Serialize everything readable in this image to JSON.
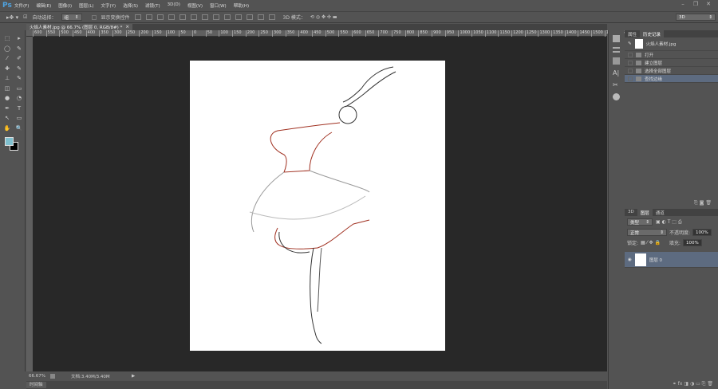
{
  "app": {
    "logo": "Ps"
  },
  "menu": [
    "文件(F)",
    "编辑(E)",
    "图像(I)",
    "图层(L)",
    "文字(Y)",
    "选择(S)",
    "滤镜(T)",
    "3D(D)",
    "视图(V)",
    "窗口(W)",
    "帮助(H)"
  ],
  "window_controls": [
    "–",
    "❐",
    "✕"
  ],
  "options": {
    "auto_select_label": "自动选择：",
    "auto_select_value": "组",
    "show_transform": "显示变换控件",
    "mode_3d": "3D 模式：",
    "workspace": "3D"
  },
  "document": {
    "tab_title": "火焰人素材.jpg @ 66.7% (图层 0, RGB/8#) *",
    "close": "×"
  },
  "ruler_labels": [
    "600",
    "550",
    "500",
    "450",
    "400",
    "350",
    "300",
    "250",
    "200",
    "150",
    "100",
    "50",
    "0",
    "50",
    "100",
    "150",
    "200",
    "250",
    "300",
    "350",
    "400",
    "450",
    "500",
    "550",
    "600",
    "650",
    "700",
    "750",
    "800",
    "850",
    "900",
    "950",
    "1000",
    "1050",
    "1100",
    "1150",
    "1200",
    "1250",
    "1300",
    "1350",
    "1400",
    "1450",
    "1500",
    "1550",
    "1600"
  ],
  "status": {
    "zoom": "66.67%",
    "doc": "文档:3.40M/3.40M",
    "arrow": "▶"
  },
  "timeline": {
    "label": "时间轴"
  },
  "history": {
    "tabs": [
      "属性",
      "历史记录"
    ],
    "active": 1,
    "snapshot": "火焰人素材.jpg",
    "items": [
      "打开",
      "建立图层",
      "选择全部图层",
      "查找边缘"
    ],
    "selected": 3
  },
  "layers": {
    "tabs": [
      "3D",
      "图层",
      "通道"
    ],
    "active": 1,
    "filter": "类型",
    "blend": "正常",
    "opacity_label": "不透明度:",
    "opacity": "100%",
    "lock_label": "锁定:",
    "fill_label": "填充:",
    "fill": "100%",
    "items": [
      {
        "name": "图层 0"
      }
    ]
  },
  "colors": {
    "foreground": "#7fc0cf",
    "background": "#000000",
    "accent": "#5d6b80"
  }
}
